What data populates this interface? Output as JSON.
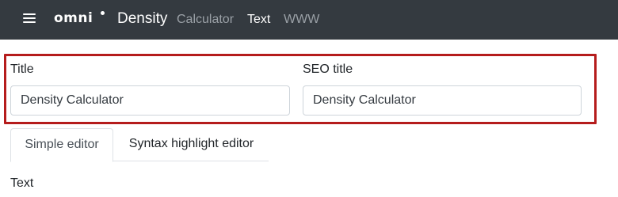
{
  "header": {
    "logo_text": "omni",
    "title": "Density",
    "nav": {
      "calculator": "Calculator",
      "text": "Text",
      "www": "WWW"
    }
  },
  "form": {
    "title": {
      "label": "Title",
      "value": "Density Calculator"
    },
    "seo_title": {
      "label": "SEO title",
      "value": "Density Calculator"
    }
  },
  "editor_tabs": {
    "simple": "Simple editor",
    "syntax": "Syntax highlight editor"
  },
  "text_section": {
    "label": "Text"
  },
  "colors": {
    "topbar": "#343a40",
    "highlight_border": "#b51c1c",
    "nav_muted": "#9aa0a6"
  }
}
